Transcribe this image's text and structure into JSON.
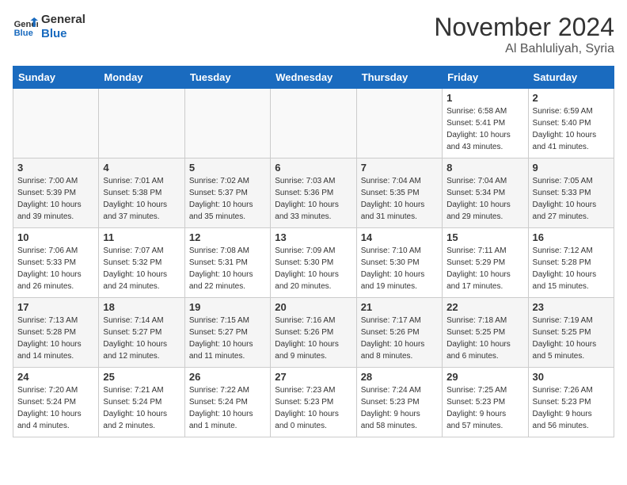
{
  "header": {
    "logo_line1": "General",
    "logo_line2": "Blue",
    "month": "November 2024",
    "location": "Al Bahluliyah, Syria"
  },
  "weekdays": [
    "Sunday",
    "Monday",
    "Tuesday",
    "Wednesday",
    "Thursday",
    "Friday",
    "Saturday"
  ],
  "weeks": [
    [
      {
        "day": "",
        "info": ""
      },
      {
        "day": "",
        "info": ""
      },
      {
        "day": "",
        "info": ""
      },
      {
        "day": "",
        "info": ""
      },
      {
        "day": "",
        "info": ""
      },
      {
        "day": "1",
        "info": "Sunrise: 6:58 AM\nSunset: 5:41 PM\nDaylight: 10 hours\nand 43 minutes."
      },
      {
        "day": "2",
        "info": "Sunrise: 6:59 AM\nSunset: 5:40 PM\nDaylight: 10 hours\nand 41 minutes."
      }
    ],
    [
      {
        "day": "3",
        "info": "Sunrise: 7:00 AM\nSunset: 5:39 PM\nDaylight: 10 hours\nand 39 minutes."
      },
      {
        "day": "4",
        "info": "Sunrise: 7:01 AM\nSunset: 5:38 PM\nDaylight: 10 hours\nand 37 minutes."
      },
      {
        "day": "5",
        "info": "Sunrise: 7:02 AM\nSunset: 5:37 PM\nDaylight: 10 hours\nand 35 minutes."
      },
      {
        "day": "6",
        "info": "Sunrise: 7:03 AM\nSunset: 5:36 PM\nDaylight: 10 hours\nand 33 minutes."
      },
      {
        "day": "7",
        "info": "Sunrise: 7:04 AM\nSunset: 5:35 PM\nDaylight: 10 hours\nand 31 minutes."
      },
      {
        "day": "8",
        "info": "Sunrise: 7:04 AM\nSunset: 5:34 PM\nDaylight: 10 hours\nand 29 minutes."
      },
      {
        "day": "9",
        "info": "Sunrise: 7:05 AM\nSunset: 5:33 PM\nDaylight: 10 hours\nand 27 minutes."
      }
    ],
    [
      {
        "day": "10",
        "info": "Sunrise: 7:06 AM\nSunset: 5:33 PM\nDaylight: 10 hours\nand 26 minutes."
      },
      {
        "day": "11",
        "info": "Sunrise: 7:07 AM\nSunset: 5:32 PM\nDaylight: 10 hours\nand 24 minutes."
      },
      {
        "day": "12",
        "info": "Sunrise: 7:08 AM\nSunset: 5:31 PM\nDaylight: 10 hours\nand 22 minutes."
      },
      {
        "day": "13",
        "info": "Sunrise: 7:09 AM\nSunset: 5:30 PM\nDaylight: 10 hours\nand 20 minutes."
      },
      {
        "day": "14",
        "info": "Sunrise: 7:10 AM\nSunset: 5:30 PM\nDaylight: 10 hours\nand 19 minutes."
      },
      {
        "day": "15",
        "info": "Sunrise: 7:11 AM\nSunset: 5:29 PM\nDaylight: 10 hours\nand 17 minutes."
      },
      {
        "day": "16",
        "info": "Sunrise: 7:12 AM\nSunset: 5:28 PM\nDaylight: 10 hours\nand 15 minutes."
      }
    ],
    [
      {
        "day": "17",
        "info": "Sunrise: 7:13 AM\nSunset: 5:28 PM\nDaylight: 10 hours\nand 14 minutes."
      },
      {
        "day": "18",
        "info": "Sunrise: 7:14 AM\nSunset: 5:27 PM\nDaylight: 10 hours\nand 12 minutes."
      },
      {
        "day": "19",
        "info": "Sunrise: 7:15 AM\nSunset: 5:27 PM\nDaylight: 10 hours\nand 11 minutes."
      },
      {
        "day": "20",
        "info": "Sunrise: 7:16 AM\nSunset: 5:26 PM\nDaylight: 10 hours\nand 9 minutes."
      },
      {
        "day": "21",
        "info": "Sunrise: 7:17 AM\nSunset: 5:26 PM\nDaylight: 10 hours\nand 8 minutes."
      },
      {
        "day": "22",
        "info": "Sunrise: 7:18 AM\nSunset: 5:25 PM\nDaylight: 10 hours\nand 6 minutes."
      },
      {
        "day": "23",
        "info": "Sunrise: 7:19 AM\nSunset: 5:25 PM\nDaylight: 10 hours\nand 5 minutes."
      }
    ],
    [
      {
        "day": "24",
        "info": "Sunrise: 7:20 AM\nSunset: 5:24 PM\nDaylight: 10 hours\nand 4 minutes."
      },
      {
        "day": "25",
        "info": "Sunrise: 7:21 AM\nSunset: 5:24 PM\nDaylight: 10 hours\nand 2 minutes."
      },
      {
        "day": "26",
        "info": "Sunrise: 7:22 AM\nSunset: 5:24 PM\nDaylight: 10 hours\nand 1 minute."
      },
      {
        "day": "27",
        "info": "Sunrise: 7:23 AM\nSunset: 5:23 PM\nDaylight: 10 hours\nand 0 minutes."
      },
      {
        "day": "28",
        "info": "Sunrise: 7:24 AM\nSunset: 5:23 PM\nDaylight: 9 hours\nand 58 minutes."
      },
      {
        "day": "29",
        "info": "Sunrise: 7:25 AM\nSunset: 5:23 PM\nDaylight: 9 hours\nand 57 minutes."
      },
      {
        "day": "30",
        "info": "Sunrise: 7:26 AM\nSunset: 5:23 PM\nDaylight: 9 hours\nand 56 minutes."
      }
    ]
  ]
}
